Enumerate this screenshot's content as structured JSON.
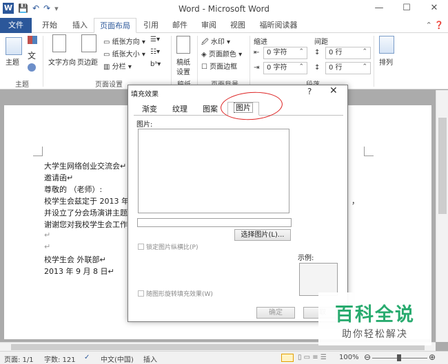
{
  "window": {
    "title": "Word - Microsoft Word",
    "qat": {
      "logo": "W",
      "save": "💾",
      "undo": "↶",
      "redo": "↷",
      "customize": "▾"
    },
    "controls": {
      "minimize": "—",
      "maximize": "☐",
      "close": "✕"
    }
  },
  "ribbon_tabs": [
    "文件",
    "开始",
    "插入",
    "页面布局",
    "引用",
    "邮件",
    "审阅",
    "视图",
    "福昕阅读器"
  ],
  "ribbon_tabs_right": "⌃ ❓",
  "ribbon": {
    "themes": {
      "theme": "主题",
      "colors_icon": "color-palette-icon",
      "fonts_icon": "font-icon",
      "effects_icon": "effects-icon",
      "label": "主题"
    },
    "page_setup": {
      "text_direction": "文字方向",
      "margins": "页边距",
      "orientation": "纸张方向 ▾",
      "size": "纸张大小 ▾",
      "columns": "分栏 ▾",
      "breaks": "▾",
      "line_numbers": "▾",
      "hyphenation": "bᵃ▾",
      "label": "页面设置"
    },
    "draft": {
      "line1": "稿纸",
      "line2": "设置",
      "label": "稿纸"
    },
    "page_background": {
      "watermark": "水印 ▾",
      "page_color": "页面颜色 ▾",
      "page_borders": "页面边框",
      "label": "页面背景"
    },
    "paragraph": {
      "indent": "缩进",
      "spacing": "间距",
      "indent_left": "0 字符",
      "indent_right": "0 字符",
      "space_before": "0 行",
      "space_after": "0 行",
      "label": "段落"
    },
    "arrange": {
      "label": "排列"
    }
  },
  "document": {
    "lines": [
      "大学生网络创业交流会↵",
      "邀请函↵",
      "尊敬的          （老师）:",
      "校学生会兹定于 2013 年",
      "并设立了分会场演讲主题",
      "谢谢您对我校学生会工作",
      "↵",
      "↵",
      "校学生会 外联部↵",
      "2013 年 9 月 8 日↵"
    ],
    "right_fragment": "，"
  },
  "dialog": {
    "title": "填充效果",
    "help": "?",
    "close": "✕",
    "tabs": [
      "渐变",
      "纹理",
      "图案",
      "图片"
    ],
    "active_tab": 3,
    "picture_label": "图片:",
    "select_button": "选择图片(L)...",
    "lock_ratio": "锁定图片纵横比(P)",
    "rotate_with_shape": "随图形旋转填充效果(W)",
    "sample_label": "示例:",
    "ok": "确定",
    "cancel": "取"
  },
  "statusbar": {
    "page": "页面: 1/1",
    "words": "字数: 121",
    "proof_icon": "✓",
    "language": "中文(中国)",
    "mode": "插入",
    "zoom": "100%",
    "zoom_out": "⊖",
    "zoom_in": "⊕"
  },
  "watermark": {
    "main": "百科全说",
    "sub": "助你轻松解决"
  }
}
